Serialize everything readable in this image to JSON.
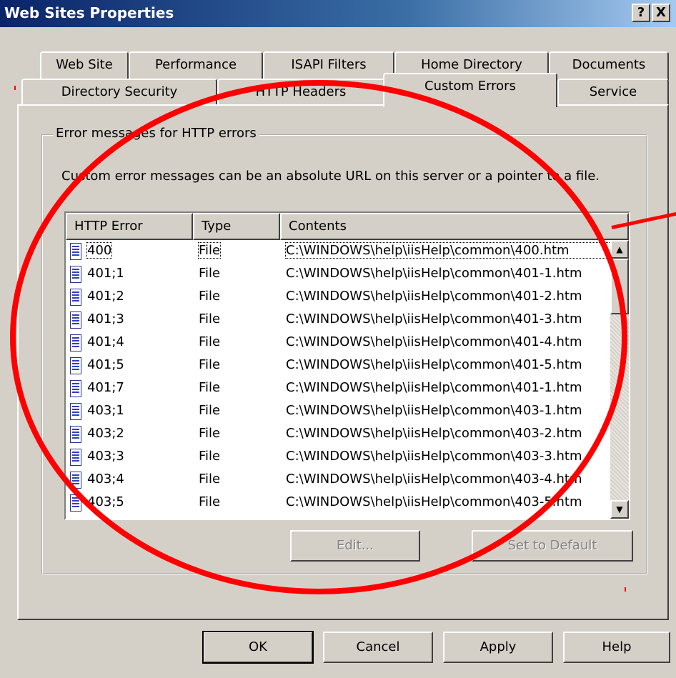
{
  "window": {
    "title": "Web Sites Properties",
    "help_button": "?",
    "close_button": "X"
  },
  "tabs_row1": [
    "Web Site",
    "Performance",
    "ISAPI Filters",
    "Home Directory",
    "Documents"
  ],
  "tabs_row2": [
    "Directory Security",
    "HTTP Headers",
    "Custom Errors",
    "Service"
  ],
  "active_tab": "Custom Errors",
  "group": {
    "legend": "Error messages for HTTP errors",
    "description": "Custom error messages can be an absolute URL on this server or a pointer to a file."
  },
  "list": {
    "columns": [
      "HTTP Error",
      "Type",
      "Contents"
    ],
    "rows": [
      {
        "error": "400",
        "type": "File",
        "contents": "C:\\WINDOWS\\help\\iisHelp\\common\\400.htm"
      },
      {
        "error": "401;1",
        "type": "File",
        "contents": "C:\\WINDOWS\\help\\iisHelp\\common\\401-1.htm"
      },
      {
        "error": "401;2",
        "type": "File",
        "contents": "C:\\WINDOWS\\help\\iisHelp\\common\\401-2.htm"
      },
      {
        "error": "401;3",
        "type": "File",
        "contents": "C:\\WINDOWS\\help\\iisHelp\\common\\401-3.htm"
      },
      {
        "error": "401;4",
        "type": "File",
        "contents": "C:\\WINDOWS\\help\\iisHelp\\common\\401-4.htm"
      },
      {
        "error": "401;5",
        "type": "File",
        "contents": "C:\\WINDOWS\\help\\iisHelp\\common\\401-5.htm"
      },
      {
        "error": "401;7",
        "type": "File",
        "contents": "C:\\WINDOWS\\help\\iisHelp\\common\\401-1.htm"
      },
      {
        "error": "403;1",
        "type": "File",
        "contents": "C:\\WINDOWS\\help\\iisHelp\\common\\403-1.htm"
      },
      {
        "error": "403;2",
        "type": "File",
        "contents": "C:\\WINDOWS\\help\\iisHelp\\common\\403-2.htm"
      },
      {
        "error": "403;3",
        "type": "File",
        "contents": "C:\\WINDOWS\\help\\iisHelp\\common\\403-3.htm"
      },
      {
        "error": "403;4",
        "type": "File",
        "contents": "C:\\WINDOWS\\help\\iisHelp\\common\\403-4.htm"
      },
      {
        "error": "403;5",
        "type": "File",
        "contents": "C:\\WINDOWS\\help\\iisHelp\\common\\403-5.htm"
      }
    ]
  },
  "buttons": {
    "edit": "Edit...",
    "set_default": "Set to Default",
    "ok": "OK",
    "cancel": "Cancel",
    "apply": "Apply",
    "help": "Help"
  },
  "colors": {
    "dialog_bg": "#d4d0c8",
    "titlebar_start": "#0a246a",
    "titlebar_end": "#a6caf0",
    "annotation": "#ff0000"
  }
}
